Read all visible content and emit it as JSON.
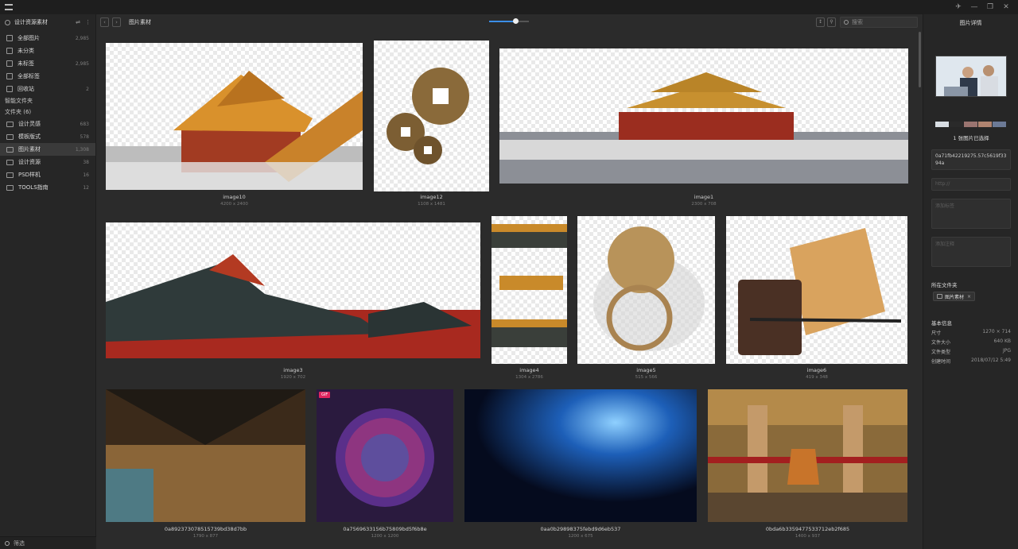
{
  "library": {
    "name": "设计资源素材"
  },
  "nav": [
    {
      "label": "全部图片",
      "count": "2,985"
    },
    {
      "label": "未分类",
      "count": ""
    },
    {
      "label": "未标签",
      "count": "2,985"
    },
    {
      "label": "全部标签",
      "count": ""
    },
    {
      "label": "回收站",
      "count": "2"
    }
  ],
  "smart_folders_title": "智能文件夹",
  "folders_title": "文件夹 (6)",
  "folders": [
    {
      "label": "设计灵感",
      "count": "683"
    },
    {
      "label": "模板版式",
      "count": "578"
    },
    {
      "label": "图片素材",
      "count": "1,308"
    },
    {
      "label": "设计资源",
      "count": "38"
    },
    {
      "label": "PSD样机",
      "count": "16"
    },
    {
      "label": "TOOLS指南",
      "count": "12"
    }
  ],
  "sidebar_filter": "筛选",
  "toolbar": {
    "back": "‹",
    "forward": "›",
    "breadcrumb": "图片素材",
    "zoom_level": 0.65,
    "sort_icon": "sort-icon",
    "filter_icon": "filter-icon",
    "search_placeholder": "搜索"
  },
  "items": [
    {
      "name": "image10",
      "size": "4200 x 2400"
    },
    {
      "name": "image12",
      "size": "1108 x 1481"
    },
    {
      "name": "image1",
      "size": "2300 x 708"
    },
    {
      "name": "image3",
      "size": "1920 x 702"
    },
    {
      "name": "image4",
      "size": "1304 x 2786"
    },
    {
      "name": "image5",
      "size": "515 x 566"
    },
    {
      "name": "image6",
      "size": "419 x 348"
    },
    {
      "name": "0a892373078515739bd38d7bb",
      "size": "1790 x 877"
    },
    {
      "name": "0a7569633156b75809bd5f6b8e",
      "size": "1200 x 1200",
      "badge": "GIF"
    },
    {
      "name": "0aa0b29898375febd9d6eb537",
      "size": "1200 x 675"
    },
    {
      "name": "0bda6b3359477533712eb2f685",
      "size": "1400 x 937"
    }
  ],
  "inspector": {
    "title": "图片详情",
    "swatches": [
      "#d8dde3",
      "#2a2a2a",
      "#9a7470",
      "#b08470",
      "#6c7a96"
    ],
    "selection_text": "1 张图片已选择",
    "id_value": "0a71fb42219275.57c5619f3394a",
    "url_placeholder": "http://",
    "tags_placeholder": "添加标签",
    "notes_placeholder": "添加注释",
    "folder_section": "所在文件夹",
    "folder_chip": "图片素材",
    "basic_section": "基本信息",
    "info": [
      {
        "key": "尺寸",
        "value": "1270 × 714"
      },
      {
        "key": "文件大小",
        "value": "640 KB"
      },
      {
        "key": "文件类型",
        "value": "JPG"
      },
      {
        "key": "创建时间",
        "value": "2018/07/12 5:49"
      }
    ]
  }
}
